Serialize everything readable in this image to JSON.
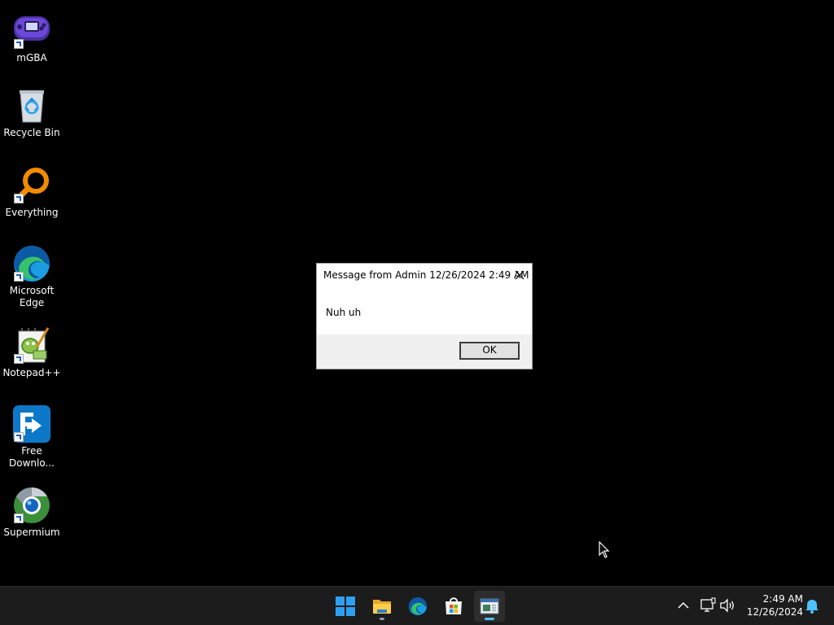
{
  "desktop": {
    "icons": [
      {
        "label": "mGBA",
        "icon": "gameboy-advance-icon"
      },
      {
        "label": "Recycle Bin",
        "icon": "recycle-bin-icon"
      },
      {
        "label": "Everything",
        "icon": "magnifier-icon"
      },
      {
        "label_line1": "Microsoft",
        "label_line2": "Edge",
        "icon": "edge-icon"
      },
      {
        "label": "Notepad++",
        "icon": "notepad-plus-plus-icon"
      },
      {
        "label_line1": "Free",
        "label_line2": "Downlo...",
        "icon": "free-download-manager-icon"
      },
      {
        "label": "Supermium",
        "icon": "supermium-browser-icon"
      }
    ]
  },
  "dialog": {
    "title": "Message from Admin 12/26/2024 2:49 AM",
    "message": "Nuh uh",
    "ok_label": "OK"
  },
  "taskbar": {
    "apps": [
      {
        "name": "Start",
        "icon": "windows-logo-icon"
      },
      {
        "name": "File Explorer",
        "icon": "folder-icon",
        "running": true
      },
      {
        "name": "Microsoft Edge",
        "icon": "edge-icon"
      },
      {
        "name": "Microsoft Store",
        "icon": "store-icon"
      },
      {
        "name": "Message window",
        "icon": "message-window-icon",
        "active": true
      }
    ],
    "tray": {
      "time": "2:49 AM",
      "date": "12/26/2024"
    }
  },
  "colors": {
    "desktop_background": "#000000",
    "taskbar_background": "#1c1c1c",
    "accent": "#4cc2ff",
    "dialog_footer": "#f0f0f0"
  }
}
